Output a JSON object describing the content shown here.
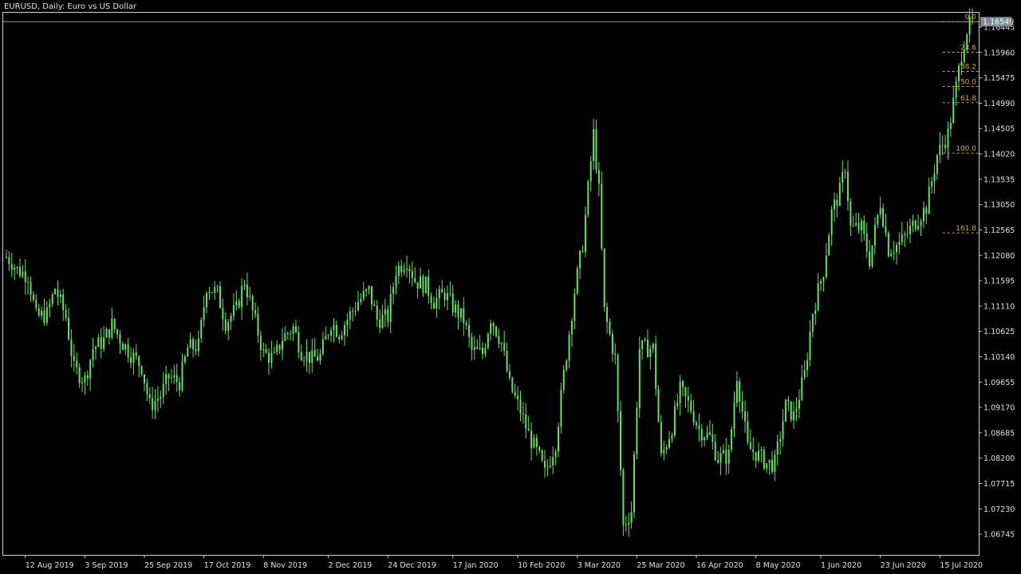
{
  "title": "EURUSD, Daily:  Euro vs US Dollar",
  "colors": {
    "background": "#000000",
    "frame": "#d0d0d0",
    "candle": "#66e060",
    "axis_text": "#e0e0e0",
    "fib": "#d4a24c",
    "price_label_bg": "#7d8a99",
    "price_label_text": "#ffffff"
  },
  "current_price_label": "1.16549",
  "chart_data": {
    "type": "candlestick",
    "title": "EURUSD, Daily:  Euro vs US Dollar",
    "grid": false,
    "ylim": [
      1.0635,
      1.1672
    ],
    "xlim": [
      "2019-08-05",
      "2020-07-27"
    ],
    "y_ticks": [
      1.16445,
      1.1596,
      1.15475,
      1.1499,
      1.14505,
      1.1402,
      1.13535,
      1.1305,
      1.12565,
      1.1208,
      1.11595,
      1.1111,
      1.10625,
      1.1014,
      1.09655,
      1.0917,
      1.08685,
      1.082,
      1.07715,
      1.0723,
      1.06745
    ],
    "y_tick_labels": [
      "1.16445",
      "1.15960",
      "1.15475",
      "1.14990",
      "1.14505",
      "1.14020",
      "1.13535",
      "1.13050",
      "1.12565",
      "1.12080",
      "1.11595",
      "1.11110",
      "1.10625",
      "1.10140",
      "1.09655",
      "1.09170",
      "1.08685",
      "1.08200",
      "1.07715",
      "1.07230",
      "1.06745"
    ],
    "x_ticks": [
      {
        "date": "2019-08-12",
        "label": "12 Aug 2019"
      },
      {
        "date": "2019-09-03",
        "label": "3 Sep 2019"
      },
      {
        "date": "2019-09-25",
        "label": "25 Sep 2019"
      },
      {
        "date": "2019-10-17",
        "label": "17 Oct 2019"
      },
      {
        "date": "2019-11-08",
        "label": "8 Nov 2019"
      },
      {
        "date": "2019-12-02",
        "label": "2 Dec 2019"
      },
      {
        "date": "2019-12-24",
        "label": "24 Dec 2019"
      },
      {
        "date": "2020-01-17",
        "label": "17 Jan 2020"
      },
      {
        "date": "2020-02-10",
        "label": "10 Feb 2020"
      },
      {
        "date": "2020-03-03",
        "label": "3 Mar 2020"
      },
      {
        "date": "2020-03-25",
        "label": "25 Mar 2020"
      },
      {
        "date": "2020-04-16",
        "label": "16 Apr 2020"
      },
      {
        "date": "2020-05-08",
        "label": "8 May 2020"
      },
      {
        "date": "2020-06-01",
        "label": "1 Jun 2020"
      },
      {
        "date": "2020-06-23",
        "label": "23 Jun 2020"
      },
      {
        "date": "2020-07-15",
        "label": "15 Jul 2020"
      }
    ],
    "close_series": [
      [
        "2019-08-05",
        1.1205
      ],
      [
        "2019-08-07",
        1.1195
      ],
      [
        "2019-08-09",
        1.118
      ],
      [
        "2019-08-13",
        1.117
      ],
      [
        "2019-08-16",
        1.109
      ],
      [
        "2019-08-20",
        1.1095
      ],
      [
        "2019-08-23",
        1.1145
      ],
      [
        "2019-08-27",
        1.109
      ],
      [
        "2019-08-30",
        1.099
      ],
      [
        "2019-09-03",
        1.097
      ],
      [
        "2019-09-06",
        1.103
      ],
      [
        "2019-09-10",
        1.1045
      ],
      [
        "2019-09-13",
        1.1075
      ],
      [
        "2019-09-17",
        1.104
      ],
      [
        "2019-09-20",
        1.102
      ],
      [
        "2019-09-24",
        1.0995
      ],
      [
        "2019-09-27",
        1.092
      ],
      [
        "2019-10-01",
        1.094
      ],
      [
        "2019-10-04",
        1.0975
      ],
      [
        "2019-10-08",
        1.0965
      ],
      [
        "2019-10-11",
        1.103
      ],
      [
        "2019-10-15",
        1.1035
      ],
      [
        "2019-10-18",
        1.115
      ],
      [
        "2019-10-22",
        1.1135
      ],
      [
        "2019-10-25",
        1.108
      ],
      [
        "2019-10-29",
        1.1105
      ],
      [
        "2019-11-01",
        1.116
      ],
      [
        "2019-11-05",
        1.108
      ],
      [
        "2019-11-08",
        1.102
      ],
      [
        "2019-11-12",
        1.101
      ],
      [
        "2019-11-15",
        1.105
      ],
      [
        "2019-11-19",
        1.107
      ],
      [
        "2019-11-22",
        1.1025
      ],
      [
        "2019-11-26",
        1.101
      ],
      [
        "2019-11-29",
        1.1015
      ],
      [
        "2019-12-03",
        1.108
      ],
      [
        "2019-12-06",
        1.106
      ],
      [
        "2019-12-10",
        1.1095
      ],
      [
        "2019-12-13",
        1.112
      ],
      [
        "2019-12-17",
        1.114
      ],
      [
        "2019-12-20",
        1.1085
      ],
      [
        "2019-12-24",
        1.109
      ],
      [
        "2019-12-27",
        1.118
      ],
      [
        "2019-12-31",
        1.12
      ],
      [
        "2020-01-03",
        1.116
      ],
      [
        "2020-01-07",
        1.115
      ],
      [
        "2020-01-10",
        1.112
      ],
      [
        "2020-01-14",
        1.1135
      ],
      [
        "2020-01-17",
        1.111
      ],
      [
        "2020-01-21",
        1.1085
      ],
      [
        "2020-01-24",
        1.1025
      ],
      [
        "2020-01-28",
        1.102
      ],
      [
        "2020-01-31",
        1.109
      ],
      [
        "2020-02-04",
        1.104
      ],
      [
        "2020-02-07",
        1.096
      ],
      [
        "2020-02-11",
        1.091
      ],
      [
        "2020-02-14",
        1.0865
      ],
      [
        "2020-02-18",
        1.082
      ],
      [
        "2020-02-20",
        1.079
      ],
      [
        "2020-02-24",
        1.085
      ],
      [
        "2020-02-27",
        1.098
      ],
      [
        "2020-03-02",
        1.114
      ],
      [
        "2020-03-05",
        1.123
      ],
      [
        "2020-03-09",
        1.144
      ],
      [
        "2020-03-11",
        1.133
      ],
      [
        "2020-03-13",
        1.11
      ],
      [
        "2020-03-17",
        1.101
      ],
      [
        "2020-03-20",
        1.069
      ],
      [
        "2020-03-23",
        1.072
      ],
      [
        "2020-03-26",
        1.103
      ],
      [
        "2020-03-31",
        1.103
      ],
      [
        "2020-04-03",
        1.082
      ],
      [
        "2020-04-07",
        1.088
      ],
      [
        "2020-04-10",
        1.095
      ],
      [
        "2020-04-14",
        1.0915
      ],
      [
        "2020-04-17",
        1.0875
      ],
      [
        "2020-04-21",
        1.086
      ],
      [
        "2020-04-24",
        1.082
      ],
      [
        "2020-04-28",
        1.0825
      ],
      [
        "2020-05-01",
        1.098
      ],
      [
        "2020-05-05",
        1.084
      ],
      [
        "2020-05-08",
        1.083
      ],
      [
        "2020-05-12",
        1.081
      ],
      [
        "2020-05-15",
        1.081
      ],
      [
        "2020-05-19",
        1.092
      ],
      [
        "2020-05-22",
        1.09
      ],
      [
        "2020-05-26",
        1.098
      ],
      [
        "2020-05-29",
        1.11
      ],
      [
        "2020-06-02",
        1.118
      ],
      [
        "2020-06-05",
        1.129
      ],
      [
        "2020-06-08",
        1.133
      ],
      [
        "2020-06-10",
        1.138
      ],
      [
        "2020-06-12",
        1.126
      ],
      [
        "2020-06-16",
        1.126
      ],
      [
        "2020-06-19",
        1.12
      ],
      [
        "2020-06-23",
        1.131
      ],
      [
        "2020-06-26",
        1.122
      ],
      [
        "2020-06-30",
        1.123
      ],
      [
        "2020-07-03",
        1.125
      ],
      [
        "2020-07-07",
        1.128
      ],
      [
        "2020-07-10",
        1.13
      ],
      [
        "2020-07-14",
        1.14
      ],
      [
        "2020-07-16",
        1.142
      ],
      [
        "2020-07-18",
        1.144
      ],
      [
        "2020-07-21",
        1.153
      ],
      [
        "2020-07-23",
        1.1595
      ],
      [
        "2020-07-25",
        1.164
      ],
      [
        "2020-07-27",
        1.1655
      ]
    ],
    "fibonacci_levels": [
      {
        "label": "0.0",
        "price": 1.16549
      },
      {
        "label": "23.6",
        "price": 1.15965
      },
      {
        "label": "38.2",
        "price": 1.156
      },
      {
        "label": "50.0",
        "price": 1.1531
      },
      {
        "label": "61.8",
        "price": 1.15
      },
      {
        "label": "100.0",
        "price": 1.14035
      },
      {
        "label": "161.8",
        "price": 1.1251
      }
    ],
    "fibonacci_start_date": "2020-07-16",
    "annotations": [
      "1.16549"
    ]
  }
}
